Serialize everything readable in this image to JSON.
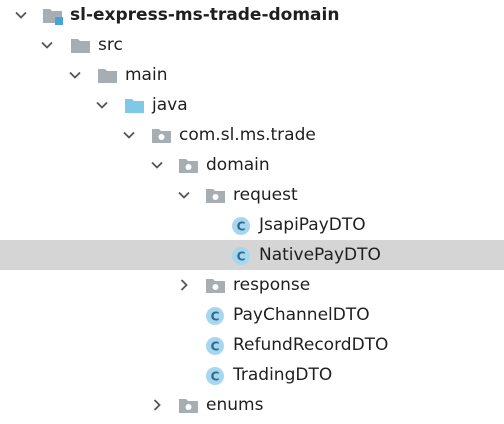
{
  "tree": {
    "project": {
      "label": "sl-express-ms-trade-domain",
      "expanded": true,
      "icon": "module-folder-icon"
    },
    "src": {
      "label": "src",
      "expanded": true,
      "icon": "folder-icon"
    },
    "main": {
      "label": "main",
      "expanded": true,
      "icon": "folder-icon"
    },
    "java": {
      "label": "java",
      "expanded": true,
      "icon": "source-root-folder-icon"
    },
    "package": {
      "label": "com.sl.ms.trade",
      "expanded": true,
      "icon": "package-icon"
    },
    "domain": {
      "label": "domain",
      "expanded": true,
      "icon": "package-icon"
    },
    "request": {
      "label": "request",
      "expanded": true,
      "icon": "package-icon"
    },
    "jsapi": {
      "label": "JsapiPayDTO",
      "icon": "class-icon",
      "icon_letter": "C"
    },
    "native": {
      "label": "NativePayDTO",
      "icon": "class-icon",
      "icon_letter": "C",
      "selected": true
    },
    "response": {
      "label": "response",
      "expanded": false,
      "icon": "package-icon"
    },
    "paychannel": {
      "label": "PayChannelDTO",
      "icon": "class-icon",
      "icon_letter": "C"
    },
    "refund": {
      "label": "RefundRecordDTO",
      "icon": "class-icon",
      "icon_letter": "C"
    },
    "trading": {
      "label": "TradingDTO",
      "icon": "class-icon",
      "icon_letter": "C"
    },
    "enums": {
      "label": "enums",
      "expanded": false,
      "icon": "package-icon"
    }
  },
  "colors": {
    "folder": "#a6adb3",
    "source_root": "#7fc8e8",
    "class_circle": "#a7d7ee",
    "class_letter": "#2b6c8c",
    "module_marker": "#4aa3d8",
    "selection": "#d5d5d5",
    "chevron": "#555555"
  }
}
